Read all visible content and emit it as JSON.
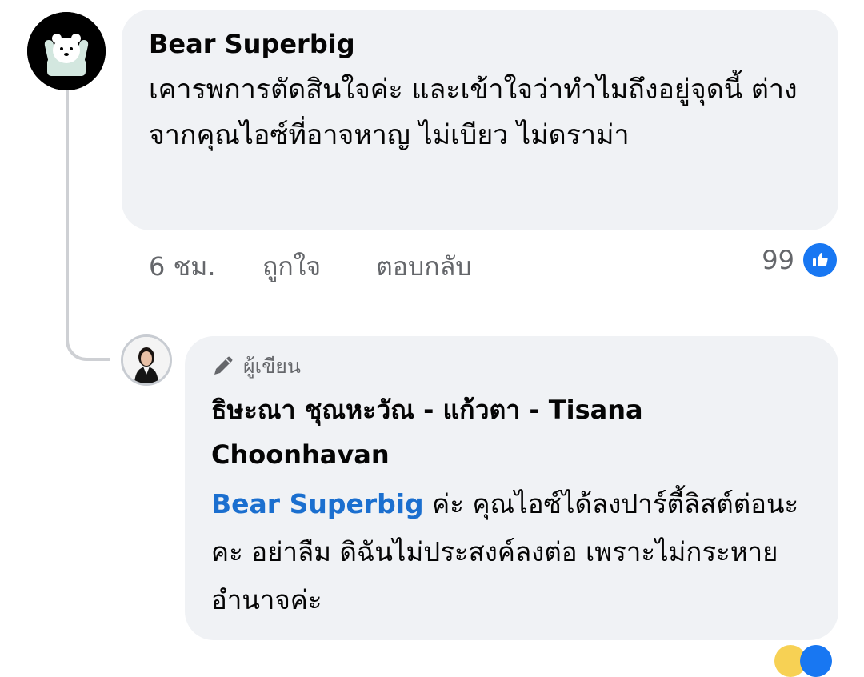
{
  "comment": {
    "author": "Bear Superbig",
    "text": "เคารพการตัดสินใจค่ะ และเข้าใจว่าทำไมถึงอยู่จุดนี้ ต่างจากคุณไอซ์ที่อาจหาญ ไม่เบียว ไม่ดราม่า",
    "time": "6 ชม.",
    "like_action": "ถูกใจ",
    "reply_action": "ตอบกลับ",
    "reaction_count": "99",
    "reaction_icon": "like-thumb-icon",
    "avatar_icon": "polar-bear-icon"
  },
  "reply": {
    "badge": "ผู้เขียน",
    "badge_icon": "pencil-icon",
    "author": "ธิษะณา ชุณหะวัณ - แก้วตา - Tisana Choonhavan",
    "mention": "Bear Superbig",
    "text": " ค่ะ คุณไอซ์ได้ลงปาร์ตี้ลิสต์ต่อนะคะ อย่าลืม ดิฉันไม่ประสงค์ลงต่อ เพราะไม่กระหายอำนาจค่ะ",
    "avatar_icon": "profile-photo"
  },
  "colors": {
    "bubble": "#f0f2f5",
    "secondary_text": "#65676b",
    "mention": "#1b6fcf",
    "like_blue": "#1877f2",
    "thread_line": "#ced0d4"
  }
}
